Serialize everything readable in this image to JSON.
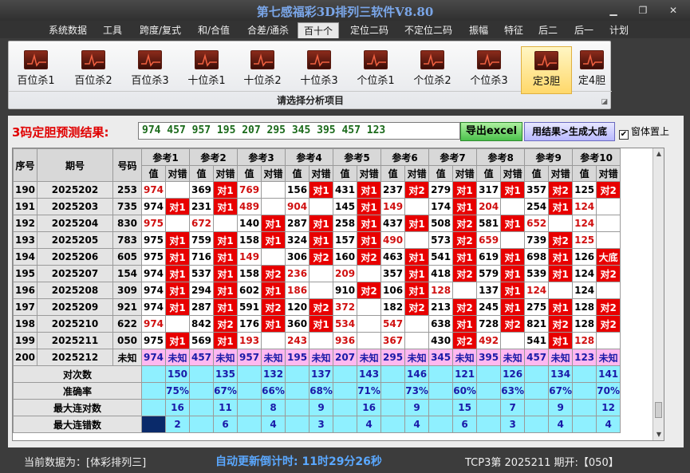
{
  "app": {
    "title": "第七感福彩3D排列三软件V8.80"
  },
  "window": {
    "minimize": "▁",
    "restore": "❐",
    "close": "✕"
  },
  "menu": [
    "系统数据",
    "工具",
    "跨度/复式",
    "和/合值",
    "合差/通杀",
    "百十个",
    "定位二码",
    "不定位二码",
    "振幅",
    "特征",
    "后二",
    "后一",
    "计划"
  ],
  "menu_active": 5,
  "ribbon": {
    "buttons": [
      "百位杀1",
      "百位杀2",
      "百位杀3",
      "十位杀1",
      "十位杀2",
      "十位杀3",
      "个位杀1",
      "个位杀2",
      "个位杀3",
      "定3胆",
      "定4胆"
    ],
    "active": 9,
    "caption": "请选择分析项目"
  },
  "result": {
    "label": "3码定胆预测结果:",
    "value": "974 457 957 195 207 295 345 395 457 123",
    "excel_button": "导出excel",
    "generate_button": "用结果>生成大底",
    "topmost_label": "窗体置上",
    "topmost_checked": "✔"
  },
  "table": {
    "headers": {
      "seq": "序号",
      "period": "期号",
      "code": "号码",
      "value": "值",
      "check": "对错"
    },
    "refs": [
      "参考1",
      "参考2",
      "参考3",
      "参考4",
      "参考5",
      "参考6",
      "参考7",
      "参考8",
      "参考9",
      "参考10"
    ],
    "rows": [
      {
        "seq": "190",
        "period": "2025202",
        "code": "253",
        "cells": [
          [
            "974",
            "",
            1
          ],
          [
            "369",
            "对1",
            0
          ],
          [
            "769",
            "",
            1
          ],
          [
            "156",
            "对1",
            0
          ],
          [
            "431",
            "对1",
            0
          ],
          [
            "237",
            "对2",
            0
          ],
          [
            "279",
            "对1",
            0
          ],
          [
            "317",
            "对1",
            0
          ],
          [
            "357",
            "对2",
            0
          ],
          [
            "125",
            "对2",
            0
          ]
        ]
      },
      {
        "seq": "191",
        "period": "2025203",
        "code": "735",
        "cells": [
          [
            "974",
            "对1",
            0
          ],
          [
            "231",
            "对1",
            0
          ],
          [
            "489",
            "",
            1
          ],
          [
            "904",
            "",
            1
          ],
          [
            "145",
            "对1",
            0
          ],
          [
            "149",
            "",
            1
          ],
          [
            "174",
            "对1",
            0
          ],
          [
            "204",
            "",
            1
          ],
          [
            "254",
            "对1",
            0
          ],
          [
            "124",
            "",
            1
          ]
        ]
      },
      {
        "seq": "192",
        "period": "2025204",
        "code": "830",
        "cells": [
          [
            "975",
            "",
            1
          ],
          [
            "672",
            "",
            1
          ],
          [
            "140",
            "对1",
            0
          ],
          [
            "287",
            "对1",
            0
          ],
          [
            "258",
            "对1",
            0
          ],
          [
            "437",
            "对1",
            0
          ],
          [
            "508",
            "对2",
            0
          ],
          [
            "581",
            "对1",
            0
          ],
          [
            "652",
            "",
            1
          ],
          [
            "124",
            "",
            1
          ]
        ]
      },
      {
        "seq": "193",
        "period": "2025205",
        "code": "783",
        "cells": [
          [
            "975",
            "对1",
            0
          ],
          [
            "759",
            "对1",
            0
          ],
          [
            "158",
            "对1",
            0
          ],
          [
            "324",
            "对1",
            0
          ],
          [
            "157",
            "对1",
            0
          ],
          [
            "490",
            "",
            1
          ],
          [
            "573",
            "对2",
            0
          ],
          [
            "659",
            "",
            1
          ],
          [
            "739",
            "对2",
            0
          ],
          [
            "125",
            "",
            1
          ]
        ]
      },
      {
        "seq": "194",
        "period": "2025206",
        "code": "605",
        "cells": [
          [
            "975",
            "对1",
            0
          ],
          [
            "716",
            "对1",
            0
          ],
          [
            "149",
            "",
            1
          ],
          [
            "306",
            "对2",
            0
          ],
          [
            "160",
            "对2",
            0
          ],
          [
            "463",
            "对1",
            0
          ],
          [
            "541",
            "对1",
            0
          ],
          [
            "619",
            "对1",
            0
          ],
          [
            "698",
            "对1",
            0
          ],
          [
            "126",
            "大底",
            0
          ]
        ]
      },
      {
        "seq": "195",
        "period": "2025207",
        "code": "154",
        "cells": [
          [
            "974",
            "对1",
            0
          ],
          [
            "537",
            "对1",
            0
          ],
          [
            "158",
            "对2",
            0
          ],
          [
            "236",
            "",
            1
          ],
          [
            "209",
            "",
            1
          ],
          [
            "357",
            "对1",
            0
          ],
          [
            "418",
            "对2",
            0
          ],
          [
            "579",
            "对1",
            0
          ],
          [
            "539",
            "对1",
            0
          ],
          [
            "124",
            "对2",
            0
          ]
        ]
      },
      {
        "seq": "196",
        "period": "2025208",
        "code": "309",
        "cells": [
          [
            "974",
            "对1",
            0
          ],
          [
            "294",
            "对1",
            0
          ],
          [
            "602",
            "对1",
            0
          ],
          [
            "186",
            "",
            1
          ],
          [
            "910",
            "对2",
            0
          ],
          [
            "106",
            "对1",
            0
          ],
          [
            "128",
            "",
            1
          ],
          [
            "137",
            "对1",
            0
          ],
          [
            "124",
            "",
            1
          ],
          [
            "124",
            "",
            2
          ]
        ]
      },
      {
        "seq": "197",
        "period": "2025209",
        "code": "921",
        "cells": [
          [
            "974",
            "对1",
            0
          ],
          [
            "287",
            "对1",
            0
          ],
          [
            "591",
            "对2",
            0
          ],
          [
            "120",
            "对2",
            0
          ],
          [
            "372",
            "",
            1
          ],
          [
            "182",
            "对2",
            0
          ],
          [
            "213",
            "对2",
            0
          ],
          [
            "245",
            "对1",
            0
          ],
          [
            "275",
            "对1",
            0
          ],
          [
            "128",
            "对2",
            0
          ]
        ]
      },
      {
        "seq": "198",
        "period": "2025210",
        "code": "622",
        "cells": [
          [
            "974",
            "",
            1
          ],
          [
            "842",
            "对2",
            0
          ],
          [
            "176",
            "对1",
            0
          ],
          [
            "360",
            "对1",
            0
          ],
          [
            "534",
            "",
            1
          ],
          [
            "547",
            "",
            1
          ],
          [
            "638",
            "对1",
            0
          ],
          [
            "728",
            "对2",
            0
          ],
          [
            "821",
            "对2",
            0
          ],
          [
            "128",
            "对2",
            0
          ]
        ]
      },
      {
        "seq": "199",
        "period": "2025211",
        "code": "050",
        "cells": [
          [
            "975",
            "对1",
            0
          ],
          [
            "569",
            "对1",
            0
          ],
          [
            "193",
            "",
            1
          ],
          [
            "243",
            "",
            1
          ],
          [
            "936",
            "",
            1
          ],
          [
            "367",
            "",
            1
          ],
          [
            "430",
            "对2",
            0
          ],
          [
            "492",
            "",
            1
          ],
          [
            "541",
            "对1",
            0
          ],
          [
            "128",
            "",
            1
          ]
        ]
      }
    ],
    "unknown_row": {
      "seq": "200",
      "period": "2025212",
      "code": "未知",
      "cells": [
        [
          "974",
          "未知"
        ],
        [
          "457",
          "未知"
        ],
        [
          "957",
          "未知"
        ],
        [
          "195",
          "未知"
        ],
        [
          "207",
          "未知"
        ],
        [
          "295",
          "未知"
        ],
        [
          "345",
          "未知"
        ],
        [
          "395",
          "未知"
        ],
        [
          "457",
          "未知"
        ],
        [
          "123",
          "未知"
        ]
      ]
    },
    "stats": [
      {
        "label": "对次数",
        "values": [
          "150",
          "135",
          "132",
          "137",
          "143",
          "146",
          "121",
          "126",
          "134",
          "141"
        ]
      },
      {
        "label": "准确率",
        "values": [
          "75%",
          "67%",
          "66%",
          "68%",
          "71%",
          "73%",
          "60%",
          "63%",
          "67%",
          "70%"
        ]
      },
      {
        "label": "最大连对数",
        "values": [
          "16",
          "11",
          "8",
          "9",
          "16",
          "9",
          "15",
          "7",
          "9",
          "12"
        ]
      },
      {
        "label": "最大连错数",
        "values": [
          "2",
          "6",
          "4",
          "3",
          "4",
          "4",
          "6",
          "3",
          "4",
          "4"
        ]
      }
    ]
  },
  "scroll": {
    "up": "▲",
    "down": "▼"
  },
  "status": {
    "data_source": "当前数据为：[体彩排列三]",
    "countdown": "自动更新倒计时:  11时29分26秒",
    "period": "TCP3第 2025211 期开:【050】"
  },
  "colors": {
    "hit": "#e80000",
    "miss_text": "#d01010",
    "unknown_row": "#ffb8f0",
    "stats_row": "#8ff0ff",
    "result_text": "#1a6a1a"
  }
}
